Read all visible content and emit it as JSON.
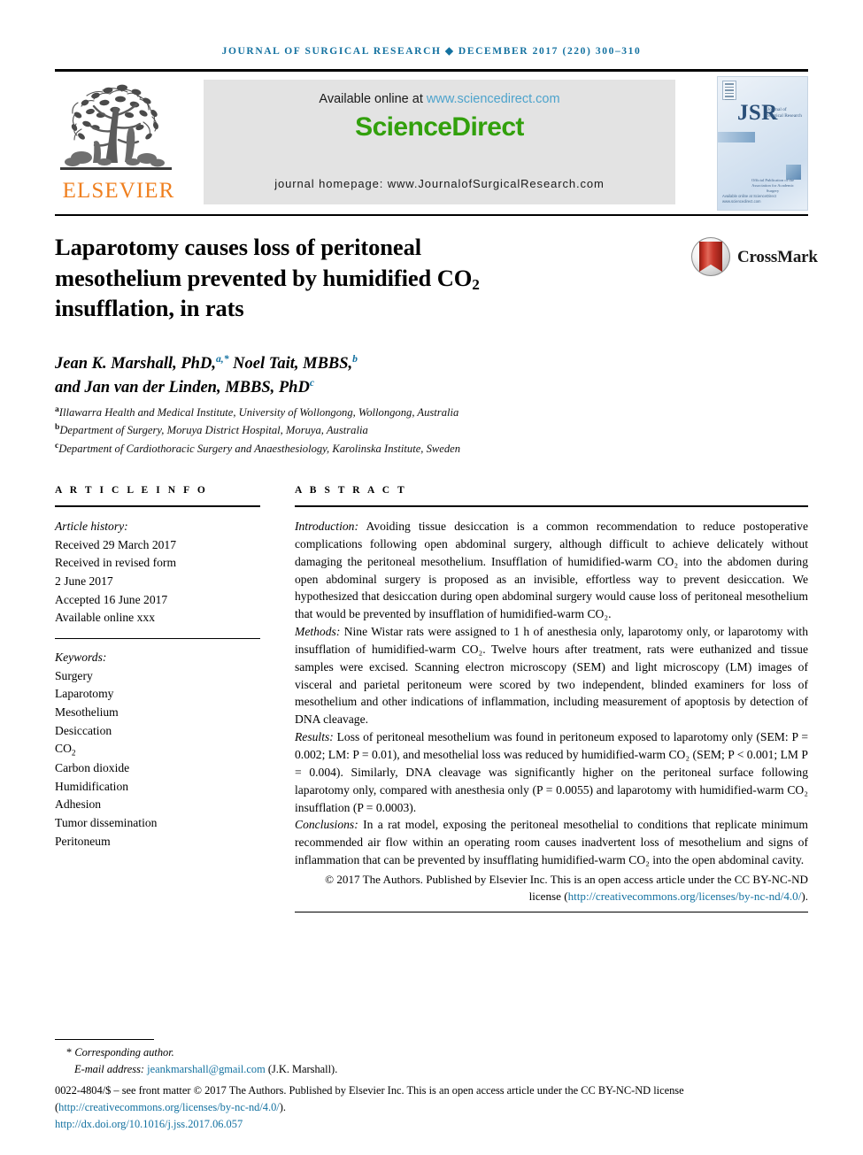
{
  "running_head": "Journal of Surgical Research ◆ December 2017 (220) 300–310",
  "masthead": {
    "publisher_name": "ELSEVIER",
    "available_text": "Available online at ",
    "sciencedirect_url": "www.sciencedirect.com",
    "wordmark": "ScienceDirect",
    "journal_homepage": "journal homepage: www.JournalofSurgicalResearch.com",
    "cover": {
      "acronym": "JSR",
      "subtitle_line1": "Journal of",
      "subtitle_line2": "Surgical Research",
      "association_line1": "Official Publication of the",
      "association_line2": "Association for Academic Surgery",
      "footer_line1": "Available online at ScienceDirect",
      "footer_line2": "www.sciencedirect.com"
    }
  },
  "article": {
    "title_line1": "Laparotomy causes loss of peritoneal",
    "title_line2_a": "mesothelium prevented by humidified CO",
    "title_line2_sub": "2",
    "title_line3": "insufflation, in rats",
    "crossmark_label": "CrossMark",
    "authors_line1_a": "Jean K. Marshall, PhD,",
    "authors_line1_sup1": "a,*",
    "authors_line1_b": " Noel Tait, MBBS,",
    "authors_line1_sup2": "b",
    "authors_line2": "and Jan van der Linden, MBBS, PhD",
    "authors_line2_sup": "c",
    "affiliations": [
      {
        "marker": "a",
        "text": "Illawarra Health and Medical Institute, University of Wollongong, Wollongong, Australia"
      },
      {
        "marker": "b",
        "text": "Department of Surgery, Moruya District Hospital, Moruya, Australia"
      },
      {
        "marker": "c",
        "text": "Department of Cardiothoracic Surgery and Anaesthesiology, Karolinska Institute, Sweden"
      }
    ]
  },
  "article_info": {
    "heading": "A R T I C L E  I N F O",
    "history_label": "Article history:",
    "history": [
      "Received 29 March 2017",
      "Received in revised form",
      "2 June 2017",
      "Accepted 16 June 2017",
      "Available online xxx"
    ],
    "keywords_label": "Keywords:",
    "keywords": [
      "Surgery",
      "Laparotomy",
      "Mesothelium",
      "Desiccation",
      "CO2",
      "Carbon dioxide",
      "Humidification",
      "Adhesion",
      "Tumor dissemination",
      "Peritoneum"
    ]
  },
  "abstract": {
    "heading": "A B S T R A C T",
    "sections": [
      {
        "label": "Introduction:",
        "text": " Avoiding tissue desiccation is a common recommendation to reduce postoperative complications following open abdominal surgery, although difficult to achieve delicately without damaging the peritoneal mesothelium. Insufflation of humidified-warm CO₂ into the abdomen during open abdominal surgery is proposed as an invisible, effortless way to prevent desiccation. We hypothesized that desiccation during open abdominal surgery would cause loss of peritoneal mesothelium that would be prevented by insufflation of humidified-warm CO₂."
      },
      {
        "label": "Methods:",
        "text": " Nine Wistar rats were assigned to 1 h of anesthesia only, laparotomy only, or laparotomy with insufflation of humidified-warm CO₂. Twelve hours after treatment, rats were euthanized and tissue samples were excised. Scanning electron microscopy (SEM) and light microscopy (LM) images of visceral and parietal peritoneum were scored by two independent, blinded examiners for loss of mesothelium and other indications of inflammation, including measurement of apoptosis by detection of DNA cleavage."
      },
      {
        "label": "Results:",
        "text": " Loss of peritoneal mesothelium was found in peritoneum exposed to laparotomy only (SEM: P = 0.002; LM: P = 0.01), and mesothelial loss was reduced by humidified-warm CO₂ (SEM; P < 0.001; LM P = 0.004). Similarly, DNA cleavage was significantly higher on the peritoneal surface following laparotomy only, compared with anesthesia only (P = 0.0055) and laparotomy with humidified-warm CO₂ insufflation (P = 0.0003)."
      },
      {
        "label": "Conclusions:",
        "text": " In a rat model, exposing the peritoneal mesothelial to conditions that replicate minimum recommended air flow within an operating room causes inadvertent loss of mesothelium and signs of inflammation that can be prevented by insufflating humidified-warm CO₂ into the open abdominal cavity."
      }
    ],
    "copyright_text": "© 2017 The Authors. Published by Elsevier Inc. This is an open access article under the CC BY-NC-ND license (",
    "copyright_link": "http://creativecommons.org/licenses/by-nc-nd/4.0/",
    "copyright_tail": ")."
  },
  "footer": {
    "corresponding_star": "*",
    "corresponding_label": "Corresponding author.",
    "email_label": "E-mail address:",
    "email": "jeankmarshall@gmail.com",
    "email_attrib": "(J.K. Marshall).",
    "issn_text": "0022-4804/$ – see front matter © 2017 The Authors. Published by Elsevier Inc. This is an open access article under the CC BY-NC-ND license (",
    "issn_link": "http://creativecommons.org/licenses/by-nc-nd/4.0/",
    "issn_tail": ").",
    "doi": "http://dx.doi.org/10.1016/j.jss.2017.06.057"
  },
  "colors": {
    "link_blue": "#1371a0",
    "sciencedirect_green": "#32a00c",
    "elsevier_orange": "#ef7f1f",
    "banner_gray": "#e3e3e3",
    "crossmark_red": "#c9372a"
  }
}
